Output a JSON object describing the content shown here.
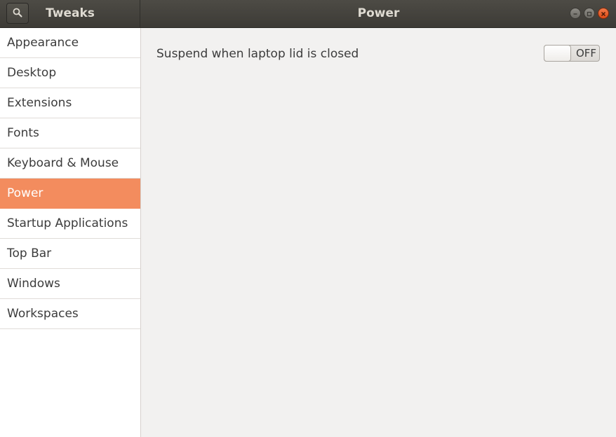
{
  "header": {
    "app_title": "Tweaks",
    "page_title": "Power"
  },
  "sidebar": {
    "items": [
      {
        "label": "Appearance"
      },
      {
        "label": "Desktop"
      },
      {
        "label": "Extensions"
      },
      {
        "label": "Fonts"
      },
      {
        "label": "Keyboard & Mouse"
      },
      {
        "label": "Power",
        "selected": true
      },
      {
        "label": "Startup Applications"
      },
      {
        "label": "Top Bar"
      },
      {
        "label": "Windows"
      },
      {
        "label": "Workspaces"
      }
    ]
  },
  "settings": {
    "suspend_lid": {
      "label": "Suspend when laptop lid is closed",
      "state": "OFF"
    }
  },
  "colors": {
    "accent": "#f38c5e",
    "headerbar": "#3d3b36",
    "close_button": "#df4b16"
  }
}
